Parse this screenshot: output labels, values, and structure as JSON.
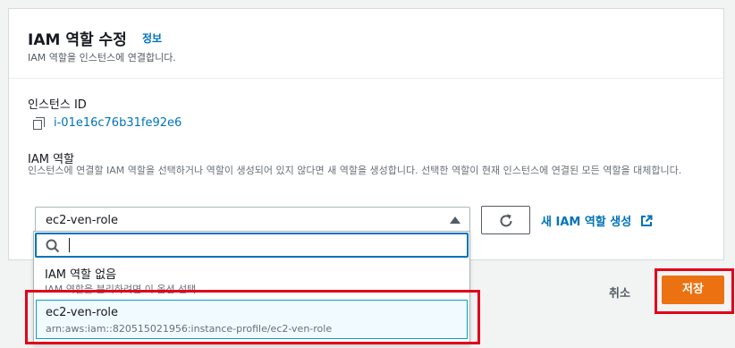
{
  "header": {
    "title": "IAM 역할 수정",
    "info_link": "정보",
    "subtitle": "IAM 역할을 인스턴스에 연결합니다."
  },
  "instance": {
    "label": "인스턴스 ID",
    "id": "i-01e16c76b31fe92e6"
  },
  "iam_role": {
    "label": "IAM 역할",
    "description": "인스턴스에 연결할 IAM 역할을 선택하거나 역할이 생성되어 있지 않다면 새 역할을 생성합니다. 선택한 역할이 현재 인스턴스에 연결된 모든 역할을 대체합니다.",
    "selected": "ec2-ven-role",
    "create_link": "새 IAM 역할 생성"
  },
  "dropdown": {
    "search_value": "",
    "options": [
      {
        "label": "IAM 역할 없음",
        "description": "IAM 역할을 분리하려면 이 옵션 선택"
      },
      {
        "label": "ec2-ven-role",
        "description": "arn:aws:iam::820515021956:instance-profile/ec2-ven-role"
      }
    ]
  },
  "footer": {
    "cancel_label": "취소",
    "save_label": "저장"
  },
  "icons": {
    "copy": "copy-icon",
    "caret": "caret-up-icon",
    "refresh": "refresh-icon",
    "external": "external-link-icon",
    "search": "search-icon"
  },
  "colors": {
    "link": "#0073bb",
    "primary_button": "#ec7211",
    "annotation": "#e0001b",
    "selected_option_bg": "#f1faff"
  }
}
